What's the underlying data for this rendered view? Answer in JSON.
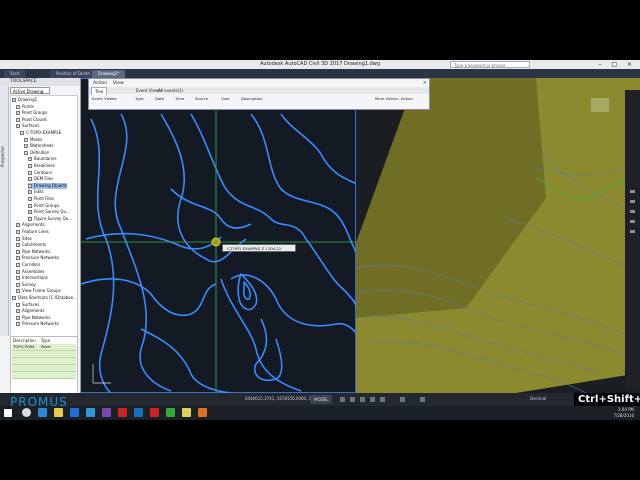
{
  "window": {
    "title": "Autodesk AutoCAD Civil 3D 2017    Drawing1.dwg",
    "search_placeholder": "Type a keyword or phrase",
    "tabs": [
      "Start",
      "Position of Death",
      "Drawing1*"
    ],
    "controls": [
      "–",
      "□",
      "×"
    ]
  },
  "toolspace": {
    "title": "TOOLSPACE",
    "view": "Active Drawing View",
    "side_tab": "Prospector",
    "tree": [
      {
        "label": "Drawing1",
        "indent": 0
      },
      {
        "label": "Points",
        "indent": 1
      },
      {
        "label": "Point Groups",
        "indent": 1
      },
      {
        "label": "Point Clouds",
        "indent": 1
      },
      {
        "label": "Surfaces",
        "indent": 1
      },
      {
        "label": "C-TOPO-EXAMPLE",
        "indent": 2
      },
      {
        "label": "Masks",
        "indent": 3
      },
      {
        "label": "Watersheds",
        "indent": 3
      },
      {
        "label": "Definition",
        "indent": 3
      },
      {
        "label": "Boundaries",
        "indent": 4
      },
      {
        "label": "Breaklines",
        "indent": 4
      },
      {
        "label": "Contours",
        "indent": 4
      },
      {
        "label": "DEM Files",
        "indent": 4
      },
      {
        "label": "Drawing Objects",
        "indent": 4
      },
      {
        "label": "Edits",
        "indent": 4
      },
      {
        "label": "Point Files",
        "indent": 4
      },
      {
        "label": "Point Groups",
        "indent": 4
      },
      {
        "label": "Point Survey Qu...",
        "indent": 4
      },
      {
        "label": "Figure Survey Qu...",
        "indent": 4
      },
      {
        "label": "Alignments",
        "indent": 1
      },
      {
        "label": "Feature Lines",
        "indent": 1
      },
      {
        "label": "Sites",
        "indent": 1
      },
      {
        "label": "Catchments",
        "indent": 1
      },
      {
        "label": "Pipe Networks",
        "indent": 1
      },
      {
        "label": "Pressure Networks",
        "indent": 1
      },
      {
        "label": "Corridors",
        "indent": 1
      },
      {
        "label": "Assemblies",
        "indent": 1
      },
      {
        "label": "Intersections",
        "indent": 1
      },
      {
        "label": "Survey",
        "indent": 1
      },
      {
        "label": "View Frame Groups",
        "indent": 1
      },
      {
        "label": "Data Shortcuts [C:\\Dropbox...",
        "indent": 0
      },
      {
        "label": "Surfaces",
        "indent": 1
      },
      {
        "label": "Alignments",
        "indent": 1
      },
      {
        "label": "Pipe Networks",
        "indent": 1
      },
      {
        "label": "Pressure Networks",
        "indent": 1
      }
    ],
    "selected_index": 13,
    "details_headers": [
      "Description",
      "Type"
    ],
    "details_row": {
      "description": "TOPO POIN",
      "type": "Point"
    }
  },
  "prospector_palette": {
    "menu": [
      "Action",
      "View"
    ],
    "tab_main": "Tree",
    "tabs": [
      "Event Viewer",
      "All events(1)"
    ],
    "tree_root": "Event Viewer",
    "columns": [
      "Type",
      "Date",
      "Time",
      "Source",
      "User",
      "Description",
      "More Inform...",
      "Action"
    ]
  },
  "tooltip": {
    "text": "C-TOPO-EXAMPLE    Z    1104.22"
  },
  "status": {
    "coordinates": "6440615.3741, 1678156.0000, 0.0000",
    "model_label": "MODEL",
    "scale_label": "Decimal",
    "logo": "PROMUS",
    "shortcut": "Ctrl+Shift+A"
  },
  "taskbar": {
    "time": "3:04 PM",
    "date": "7/28/2016"
  },
  "colors": {
    "contour_blue": "#3a8bff",
    "surface_olive": "#8b8a2e",
    "crosshair_green": "#3bb54a",
    "selection_blue": "#9ac0ea"
  }
}
